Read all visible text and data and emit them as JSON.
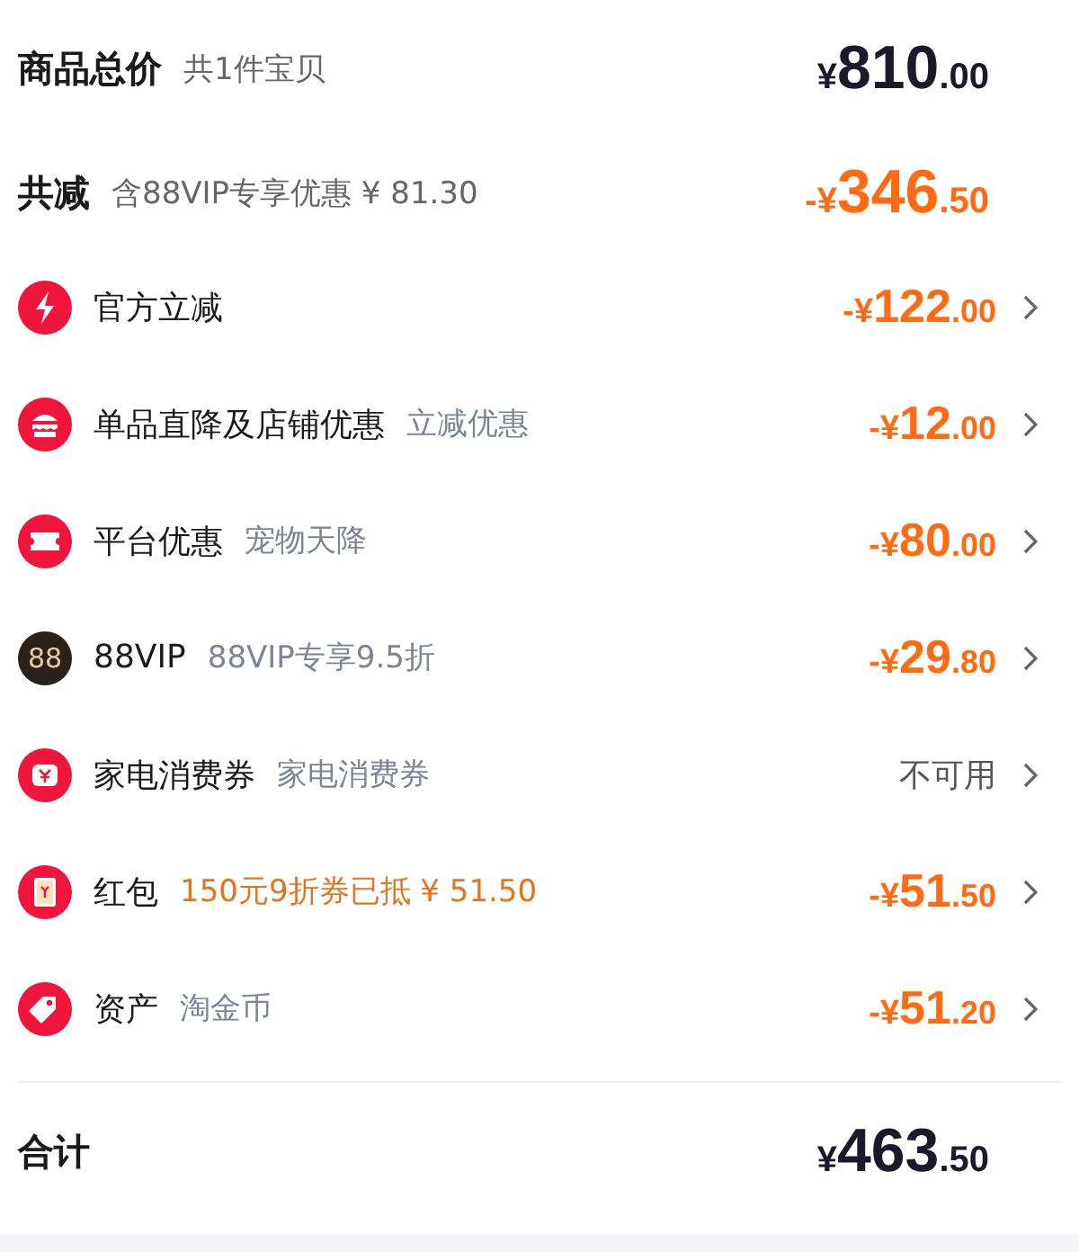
{
  "header": {
    "title": "商品总价",
    "subtitle": "共1件宝贝",
    "price": {
      "sign": "¥",
      "amount": "810",
      "cents": ".00"
    }
  },
  "reduction": {
    "title": "共减",
    "subtitle": "含88VIP专享优惠 ¥ 81.30",
    "price": {
      "sign": "-¥",
      "amount": "346",
      "cents": ".50"
    }
  },
  "items": [
    {
      "label": "官方立减",
      "price": {
        "sign": "-¥",
        "amount": "122",
        "cents": ".00"
      }
    },
    {
      "label": "单品直降及店铺优惠",
      "note": "立减优惠",
      "highlight": false,
      "price": {
        "sign": "-¥",
        "amount": "12",
        "cents": ".00"
      }
    },
    {
      "label": "平台优惠",
      "note": "宠物天降",
      "highlight": false,
      "price": {
        "sign": "-¥",
        "amount": "80",
        "cents": ".00"
      }
    },
    {
      "icon_text": "88",
      "label": "88VIP",
      "note": "88VIP专享9.5折",
      "highlight": false,
      "price": {
        "sign": "-¥",
        "amount": "29",
        "cents": ".80"
      }
    },
    {
      "label": "家电消费券",
      "note": "家电消费券",
      "highlight": false,
      "value": "不可用"
    },
    {
      "label": "红包",
      "note": "150元9折券已抵 ¥ 51.50",
      "highlight": true,
      "price": {
        "sign": "-¥",
        "amount": "51",
        "cents": ".50"
      }
    },
    {
      "label": "资产",
      "note": "淘金币",
      "highlight": false,
      "price": {
        "sign": "-¥",
        "amount": "51",
        "cents": ".20"
      }
    }
  ],
  "total": {
    "title": "合计",
    "price": {
      "sign": "¥",
      "amount": "463",
      "cents": ".50"
    }
  }
}
